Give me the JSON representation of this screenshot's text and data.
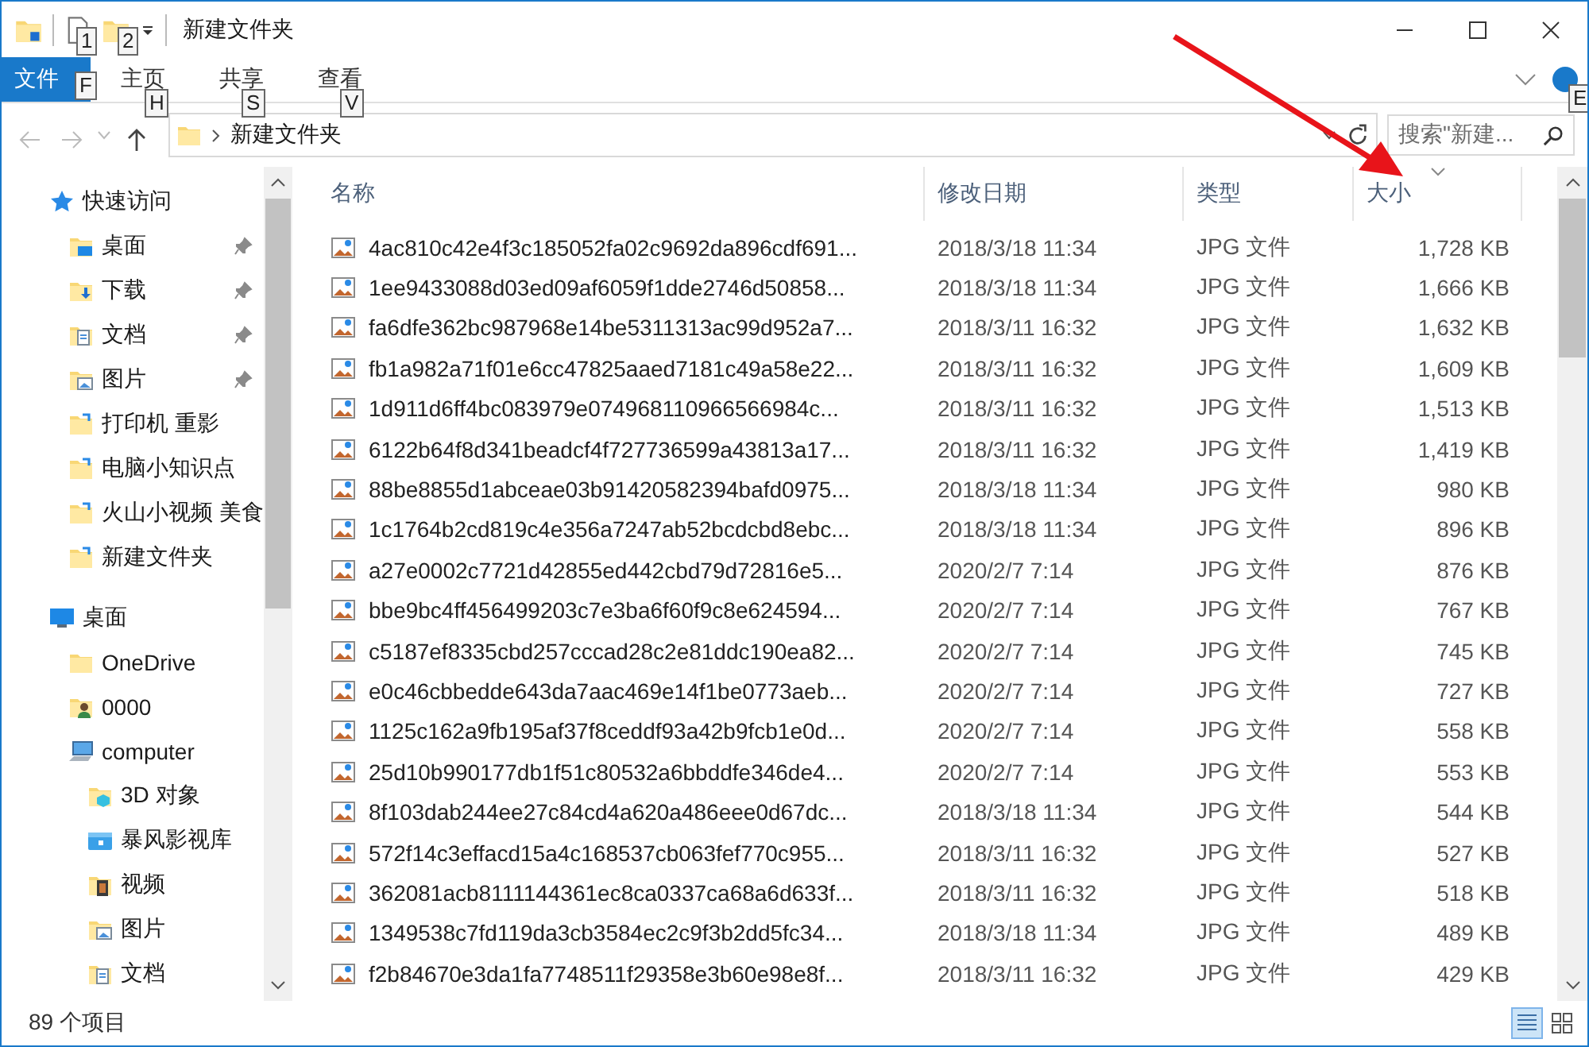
{
  "window": {
    "title": "新建文件夹",
    "quick_keytips": [
      "1",
      "2"
    ]
  },
  "ribbon": {
    "tabs": [
      {
        "label": "文件",
        "keytip": "F",
        "selected": true
      },
      {
        "label": "主页",
        "keytip": "H",
        "selected": false
      },
      {
        "label": "共享",
        "keytip": "S",
        "selected": false
      },
      {
        "label": "查看",
        "keytip": "V",
        "selected": false
      }
    ],
    "help_keytip": "E"
  },
  "address": {
    "path": "新建文件夹",
    "search_placeholder": "搜索\"新建..."
  },
  "sidebar": {
    "items": [
      {
        "label": "快速访问",
        "kind": "star",
        "pinned": false,
        "children": [
          {
            "label": "桌面",
            "kind": "folder-desktop",
            "pinned": true
          },
          {
            "label": "下载",
            "kind": "folder-download",
            "pinned": true
          },
          {
            "label": "文档",
            "kind": "folder-doc",
            "pinned": true
          },
          {
            "label": "图片",
            "kind": "folder-picture",
            "pinned": true
          },
          {
            "label": "打印机 重影",
            "kind": "folder-link",
            "pinned": false
          },
          {
            "label": "电脑小知识点",
            "kind": "folder-link",
            "pinned": false
          },
          {
            "label": "火山小视频 美食",
            "kind": "folder-link",
            "pinned": false
          },
          {
            "label": "新建文件夹",
            "kind": "folder-link",
            "pinned": false
          }
        ]
      },
      {
        "label": "桌面",
        "kind": "desktop",
        "pinned": false,
        "children": [
          {
            "label": "OneDrive",
            "kind": "folder",
            "pinned": false
          },
          {
            "label": "0000",
            "kind": "user",
            "pinned": false
          },
          {
            "label": "computer",
            "kind": "computer",
            "pinned": false,
            "children": [
              {
                "label": "3D 对象",
                "kind": "folder-3d",
                "pinned": false
              },
              {
                "label": "暴风影视库",
                "kind": "library",
                "pinned": false
              },
              {
                "label": "视频",
                "kind": "folder-video",
                "pinned": false
              },
              {
                "label": "图片",
                "kind": "folder-picture",
                "pinned": false
              },
              {
                "label": "文档",
                "kind": "folder-doc",
                "pinned": false
              }
            ]
          }
        ]
      }
    ]
  },
  "table": {
    "columns": [
      {
        "label": "名称",
        "sorted": false
      },
      {
        "label": "修改日期",
        "sorted": false
      },
      {
        "label": "类型",
        "sorted": false
      },
      {
        "label": "大小",
        "sorted": true
      }
    ],
    "rows": [
      {
        "name": "4ac810c42e4f3c185052fa02c9692da896cdf691...",
        "date": "2018/3/18 11:34",
        "type": "JPG 文件",
        "size": "1,728 KB"
      },
      {
        "name": "1ee9433088d03ed09af6059f1dde2746d50858...",
        "date": "2018/3/18 11:34",
        "type": "JPG 文件",
        "size": "1,666 KB"
      },
      {
        "name": "fa6dfe362bc987968e14be5311313ac99d952a7...",
        "date": "2018/3/11 16:32",
        "type": "JPG 文件",
        "size": "1,632 KB"
      },
      {
        "name": "fb1a982a71f01e6cc47825aaed7181c49a58e22...",
        "date": "2018/3/11 16:32",
        "type": "JPG 文件",
        "size": "1,609 KB"
      },
      {
        "name": "1d911d6ff4bc083979e074968110966566984c...",
        "date": "2018/3/11 16:32",
        "type": "JPG 文件",
        "size": "1,513 KB"
      },
      {
        "name": "6122b64f8d341beadcf4f727736599a43813a17...",
        "date": "2018/3/11 16:32",
        "type": "JPG 文件",
        "size": "1,419 KB"
      },
      {
        "name": "88be8855d1abceae03b91420582394bafd0975...",
        "date": "2018/3/18 11:34",
        "type": "JPG 文件",
        "size": "980 KB"
      },
      {
        "name": "1c1764b2cd819c4e356a7247ab52bcdcbd8ebc...",
        "date": "2018/3/18 11:34",
        "type": "JPG 文件",
        "size": "896 KB"
      },
      {
        "name": "a27e0002c7721d42855ed442cbd79d72816e5...",
        "date": "2020/2/7 7:14",
        "type": "JPG 文件",
        "size": "876 KB"
      },
      {
        "name": "bbe9bc4ff456499203c7e3ba6f60f9c8e624594...",
        "date": "2020/2/7 7:14",
        "type": "JPG 文件",
        "size": "767 KB"
      },
      {
        "name": "c5187ef8335cbd257cccad28c2e81ddc190ea82...",
        "date": "2020/2/7 7:14",
        "type": "JPG 文件",
        "size": "745 KB"
      },
      {
        "name": "e0c46cbbedde643da7aac469e14f1be0773aeb...",
        "date": "2020/2/7 7:14",
        "type": "JPG 文件",
        "size": "727 KB"
      },
      {
        "name": "1125c162a9fb195af37f8ceddf93a42b9fcb1e0d...",
        "date": "2020/2/7 7:14",
        "type": "JPG 文件",
        "size": "558 KB"
      },
      {
        "name": "25d10b990177db1f51c80532a6bbddfe346de4...",
        "date": "2020/2/7 7:14",
        "type": "JPG 文件",
        "size": "553 KB"
      },
      {
        "name": "8f103dab244ee27c84cd4a620a486eee0d67dc...",
        "date": "2018/3/18 11:34",
        "type": "JPG 文件",
        "size": "544 KB"
      },
      {
        "name": "572f14c3effacd15a4c168537cb063fef770c955...",
        "date": "2018/3/11 16:32",
        "type": "JPG 文件",
        "size": "527 KB"
      },
      {
        "name": "362081acb8111144361ec8ca0337ca68a6d633f...",
        "date": "2018/3/11 16:32",
        "type": "JPG 文件",
        "size": "518 KB"
      },
      {
        "name": "1349538c7fd119da3cb3584ec2c9f3b2dd5fc34...",
        "date": "2018/3/18 11:34",
        "type": "JPG 文件",
        "size": "489 KB"
      },
      {
        "name": "f2b84670e3da1fa7748511f29358e3b60e98e8f...",
        "date": "2018/3/11 16:32",
        "type": "JPG 文件",
        "size": "429 KB"
      }
    ]
  },
  "status_bar": {
    "item_count": "89 个项目",
    "views": [
      {
        "kind": "details",
        "selected": true
      },
      {
        "kind": "large-icons",
        "selected": false
      }
    ]
  }
}
